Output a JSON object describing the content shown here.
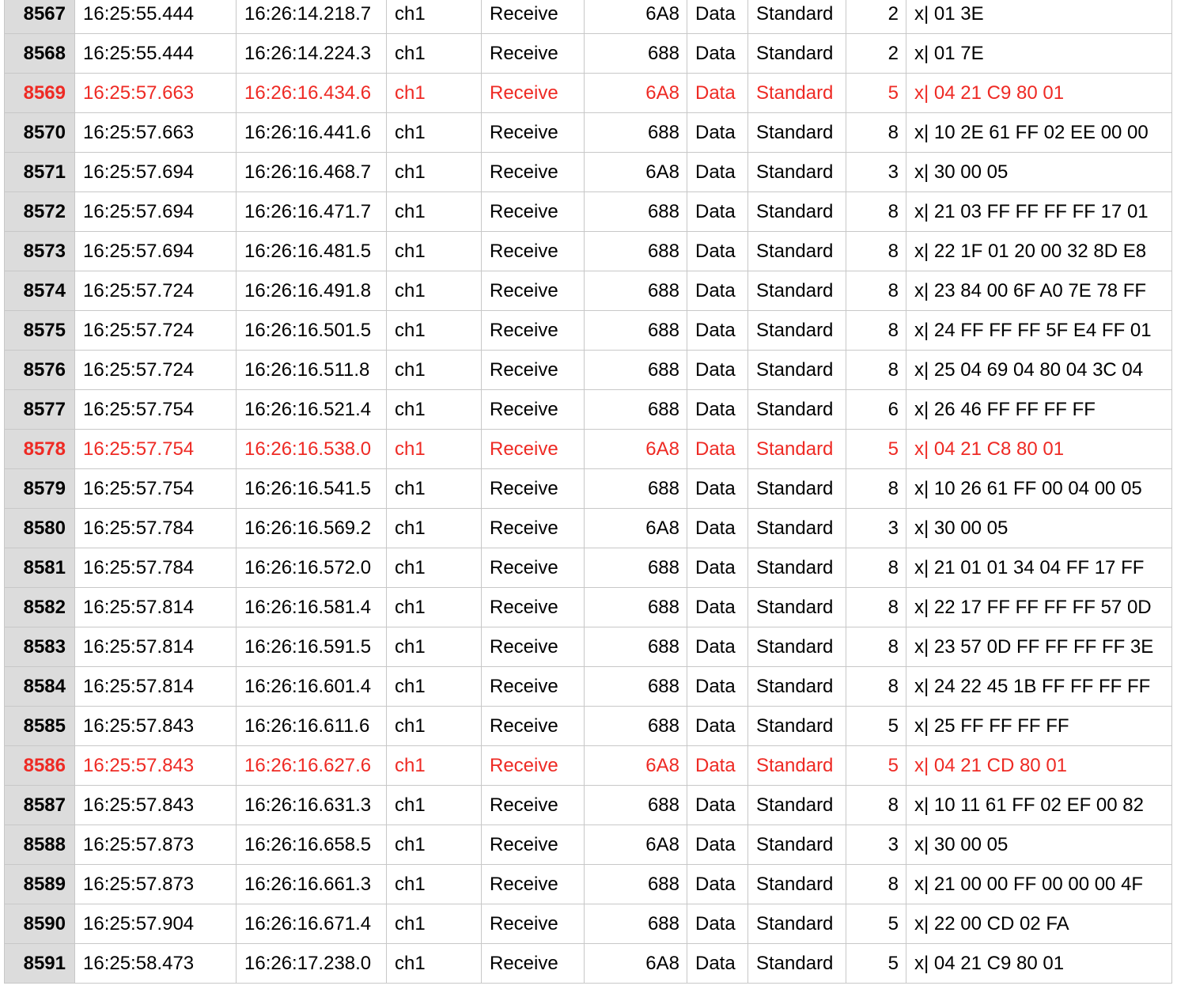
{
  "table": {
    "highlight_color": "#ee2a24",
    "index_background": "#dcdcdc",
    "rows": [
      {
        "idx": "8567",
        "t1": "16:25:55.444",
        "t2": "16:26:14.218.7",
        "ch": "ch1",
        "dir": "Receive",
        "id": "6A8",
        "type": "Data",
        "frame": "Standard",
        "dlc": "2",
        "data": "x| 01 3E",
        "hl": false
      },
      {
        "idx": "8568",
        "t1": "16:25:55.444",
        "t2": "16:26:14.224.3",
        "ch": "ch1",
        "dir": "Receive",
        "id": "688",
        "type": "Data",
        "frame": "Standard",
        "dlc": "2",
        "data": "x| 01 7E",
        "hl": false
      },
      {
        "idx": "8569",
        "t1": "16:25:57.663",
        "t2": "16:26:16.434.6",
        "ch": "ch1",
        "dir": "Receive",
        "id": "6A8",
        "type": "Data",
        "frame": "Standard",
        "dlc": "5",
        "data": "x| 04 21 C9 80 01",
        "hl": true
      },
      {
        "idx": "8570",
        "t1": "16:25:57.663",
        "t2": "16:26:16.441.6",
        "ch": "ch1",
        "dir": "Receive",
        "id": "688",
        "type": "Data",
        "frame": "Standard",
        "dlc": "8",
        "data": "x| 10 2E 61 FF 02 EE 00 00",
        "hl": false
      },
      {
        "idx": "8571",
        "t1": "16:25:57.694",
        "t2": "16:26:16.468.7",
        "ch": "ch1",
        "dir": "Receive",
        "id": "6A8",
        "type": "Data",
        "frame": "Standard",
        "dlc": "3",
        "data": "x| 30 00 05",
        "hl": false
      },
      {
        "idx": "8572",
        "t1": "16:25:57.694",
        "t2": "16:26:16.471.7",
        "ch": "ch1",
        "dir": "Receive",
        "id": "688",
        "type": "Data",
        "frame": "Standard",
        "dlc": "8",
        "data": "x| 21 03 FF FF FF FF 17 01",
        "hl": false
      },
      {
        "idx": "8573",
        "t1": "16:25:57.694",
        "t2": "16:26:16.481.5",
        "ch": "ch1",
        "dir": "Receive",
        "id": "688",
        "type": "Data",
        "frame": "Standard",
        "dlc": "8",
        "data": "x| 22 1F 01 20 00 32 8D E8",
        "hl": false
      },
      {
        "idx": "8574",
        "t1": "16:25:57.724",
        "t2": "16:26:16.491.8",
        "ch": "ch1",
        "dir": "Receive",
        "id": "688",
        "type": "Data",
        "frame": "Standard",
        "dlc": "8",
        "data": "x| 23 84 00 6F A0 7E 78 FF",
        "hl": false
      },
      {
        "idx": "8575",
        "t1": "16:25:57.724",
        "t2": "16:26:16.501.5",
        "ch": "ch1",
        "dir": "Receive",
        "id": "688",
        "type": "Data",
        "frame": "Standard",
        "dlc": "8",
        "data": "x| 24 FF FF FF 5F E4 FF 01",
        "hl": false
      },
      {
        "idx": "8576",
        "t1": "16:25:57.724",
        "t2": "16:26:16.511.8",
        "ch": "ch1",
        "dir": "Receive",
        "id": "688",
        "type": "Data",
        "frame": "Standard",
        "dlc": "8",
        "data": "x| 25 04 69 04 80 04 3C 04",
        "hl": false
      },
      {
        "idx": "8577",
        "t1": "16:25:57.754",
        "t2": "16:26:16.521.4",
        "ch": "ch1",
        "dir": "Receive",
        "id": "688",
        "type": "Data",
        "frame": "Standard",
        "dlc": "6",
        "data": "x| 26 46 FF FF FF FF",
        "hl": false
      },
      {
        "idx": "8578",
        "t1": "16:25:57.754",
        "t2": "16:26:16.538.0",
        "ch": "ch1",
        "dir": "Receive",
        "id": "6A8",
        "type": "Data",
        "frame": "Standard",
        "dlc": "5",
        "data": "x| 04 21 C8 80 01",
        "hl": true
      },
      {
        "idx": "8579",
        "t1": "16:25:57.754",
        "t2": "16:26:16.541.5",
        "ch": "ch1",
        "dir": "Receive",
        "id": "688",
        "type": "Data",
        "frame": "Standard",
        "dlc": "8",
        "data": "x| 10 26 61 FF 00 04 00 05",
        "hl": false
      },
      {
        "idx": "8580",
        "t1": "16:25:57.784",
        "t2": "16:26:16.569.2",
        "ch": "ch1",
        "dir": "Receive",
        "id": "6A8",
        "type": "Data",
        "frame": "Standard",
        "dlc": "3",
        "data": "x| 30 00 05",
        "hl": false
      },
      {
        "idx": "8581",
        "t1": "16:25:57.784",
        "t2": "16:26:16.572.0",
        "ch": "ch1",
        "dir": "Receive",
        "id": "688",
        "type": "Data",
        "frame": "Standard",
        "dlc": "8",
        "data": "x| 21 01 01 34 04 FF 17 FF",
        "hl": false
      },
      {
        "idx": "8582",
        "t1": "16:25:57.814",
        "t2": "16:26:16.581.4",
        "ch": "ch1",
        "dir": "Receive",
        "id": "688",
        "type": "Data",
        "frame": "Standard",
        "dlc": "8",
        "data": "x| 22 17 FF FF FF FF 57 0D",
        "hl": false
      },
      {
        "idx": "8583",
        "t1": "16:25:57.814",
        "t2": "16:26:16.591.5",
        "ch": "ch1",
        "dir": "Receive",
        "id": "688",
        "type": "Data",
        "frame": "Standard",
        "dlc": "8",
        "data": "x| 23 57 0D FF FF FF FF 3E",
        "hl": false
      },
      {
        "idx": "8584",
        "t1": "16:25:57.814",
        "t2": "16:26:16.601.4",
        "ch": "ch1",
        "dir": "Receive",
        "id": "688",
        "type": "Data",
        "frame": "Standard",
        "dlc": "8",
        "data": "x| 24 22 45 1B FF FF FF FF",
        "hl": false
      },
      {
        "idx": "8585",
        "t1": "16:25:57.843",
        "t2": "16:26:16.611.6",
        "ch": "ch1",
        "dir": "Receive",
        "id": "688",
        "type": "Data",
        "frame": "Standard",
        "dlc": "5",
        "data": "x| 25 FF FF FF FF",
        "hl": false
      },
      {
        "idx": "8586",
        "t1": "16:25:57.843",
        "t2": "16:26:16.627.6",
        "ch": "ch1",
        "dir": "Receive",
        "id": "6A8",
        "type": "Data",
        "frame": "Standard",
        "dlc": "5",
        "data": "x| 04 21 CD 80 01",
        "hl": true
      },
      {
        "idx": "8587",
        "t1": "16:25:57.843",
        "t2": "16:26:16.631.3",
        "ch": "ch1",
        "dir": "Receive",
        "id": "688",
        "type": "Data",
        "frame": "Standard",
        "dlc": "8",
        "data": "x| 10 11 61 FF 02 EF 00 82",
        "hl": false
      },
      {
        "idx": "8588",
        "t1": "16:25:57.873",
        "t2": "16:26:16.658.5",
        "ch": "ch1",
        "dir": "Receive",
        "id": "6A8",
        "type": "Data",
        "frame": "Standard",
        "dlc": "3",
        "data": "x| 30 00 05",
        "hl": false
      },
      {
        "idx": "8589",
        "t1": "16:25:57.873",
        "t2": "16:26:16.661.3",
        "ch": "ch1",
        "dir": "Receive",
        "id": "688",
        "type": "Data",
        "frame": "Standard",
        "dlc": "8",
        "data": "x| 21 00 00 FF 00 00 00 4F",
        "hl": false
      },
      {
        "idx": "8590",
        "t1": "16:25:57.904",
        "t2": "16:26:16.671.4",
        "ch": "ch1",
        "dir": "Receive",
        "id": "688",
        "type": "Data",
        "frame": "Standard",
        "dlc": "5",
        "data": "x| 22 00 CD 02 FA",
        "hl": false
      },
      {
        "idx": "8591",
        "t1": "16:25:58.473",
        "t2": "16:26:17.238.0",
        "ch": "ch1",
        "dir": "Receive",
        "id": "6A8",
        "type": "Data",
        "frame": "Standard",
        "dlc": "5",
        "data": "x| 04 21 C9 80 01",
        "hl": false
      }
    ]
  }
}
